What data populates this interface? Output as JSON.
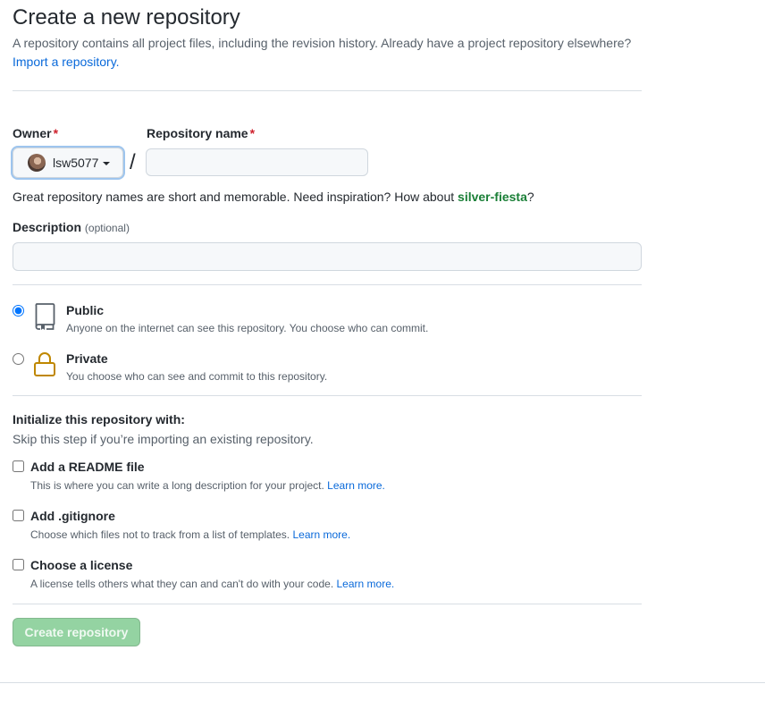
{
  "header": {
    "title": "Create a new repository",
    "description": "A repository contains all project files, including the revision history. Already have a project repository elsewhere?",
    "import_link": "Import a repository."
  },
  "owner": {
    "label": "Owner",
    "required_mark": "*",
    "value": "lsw5077"
  },
  "separator": "/",
  "repo_name": {
    "label": "Repository name",
    "required_mark": "*",
    "value": "",
    "placeholder": ""
  },
  "name_hint": {
    "prefix": "Great repository names are short and memorable. Need inspiration? How about ",
    "suggestion": "silver-fiesta",
    "suffix": "?"
  },
  "description": {
    "label": "Description",
    "optional": "(optional)",
    "value": "",
    "placeholder": ""
  },
  "visibility": {
    "selected": "public",
    "options": [
      {
        "id": "public",
        "title": "Public",
        "description": "Anyone on the internet can see this repository. You choose who can commit.",
        "icon": "repo-icon"
      },
      {
        "id": "private",
        "title": "Private",
        "description": "You choose who can see and commit to this repository.",
        "icon": "lock-icon"
      }
    ]
  },
  "initialize": {
    "title": "Initialize this repository with:",
    "subtitle": "Skip this step if you’re importing an existing repository.",
    "options": [
      {
        "title": "Add a README file",
        "description": "This is where you can write a long description for your project.",
        "link": "Learn more.",
        "checked": false
      },
      {
        "title": "Add .gitignore",
        "description": "Choose which files not to track from a list of templates.",
        "link": "Learn more.",
        "checked": false
      },
      {
        "title": "Choose a license",
        "description": "A license tells others what they can and can't do with your code.",
        "link": "Learn more.",
        "checked": false
      }
    ]
  },
  "submit": {
    "label": "Create repository",
    "disabled": true
  },
  "colors": {
    "link": "#0969da",
    "required": "#cf222e",
    "suggestion": "#1a7f37",
    "button_disabled": "#94d3a2",
    "lock": "#bf8700"
  }
}
